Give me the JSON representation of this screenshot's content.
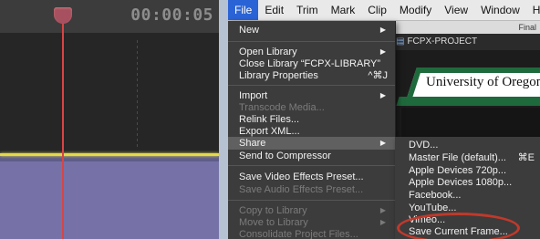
{
  "timeline": {
    "timecode": "00:00:05"
  },
  "menubar": {
    "items": [
      "File",
      "Edit",
      "Trim",
      "Mark",
      "Clip",
      "Modify",
      "View",
      "Window",
      "Help"
    ]
  },
  "window": {
    "subtitle": "Final",
    "project_name": "FCPX-PROJECT"
  },
  "viewer": {
    "banner_text": "University of Oregon"
  },
  "file_menu": {
    "new": "New",
    "open_library": "Open Library",
    "close_library": "Close Library “FCPX-LIBRARY”",
    "library_properties": "Library Properties",
    "library_properties_shortcut": "^⌘J",
    "import": "Import",
    "transcode_media": "Transcode Media...",
    "relink_files": "Relink Files...",
    "export_xml": "Export XML...",
    "share": "Share",
    "send_to_compressor": "Send to Compressor",
    "save_video_effects": "Save Video Effects Preset...",
    "save_audio_effects": "Save Audio Effects Preset...",
    "copy_to_library": "Copy to Library",
    "move_to_library": "Move to Library",
    "consolidate": "Consolidate Project Files..."
  },
  "share_menu": {
    "dvd": "DVD...",
    "master_file": "Master File (default)...",
    "master_file_shortcut": "⌘E",
    "apple_720": "Apple Devices 720p...",
    "apple_1080": "Apple Devices 1080p...",
    "facebook": "Facebook...",
    "youtube": "YouTube...",
    "vimeo": "Vimeo...",
    "save_current_frame": "Save Current Frame..."
  },
  "colors": {
    "highlight_circle": "#c0392b",
    "menu_active": "#2a63d6",
    "clip": "#7672a8",
    "playhead": "#d94444"
  }
}
